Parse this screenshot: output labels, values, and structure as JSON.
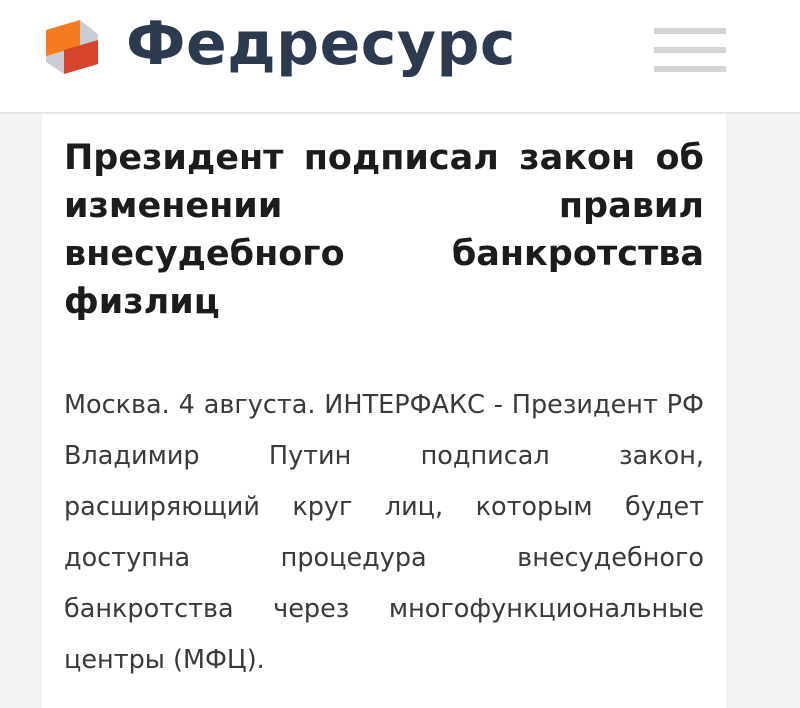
{
  "header": {
    "brand_name": "Федресурс",
    "logo_icon": "fedresurs-logo-icon",
    "menu_icon": "hamburger-menu-icon",
    "colors": {
      "brand_text": "#2b3a4f",
      "logo_orange": "#f47b20",
      "logo_red": "#d6452b",
      "logo_grey": "#c9cdd3"
    }
  },
  "article": {
    "title": "Президент подписал закон об изменении правил внесудебного банкротства физлиц",
    "lead": "Москва. 4 августа. ИНТЕРФАКС - Президент РФ Владимир Путин подписал закон, расширяющий круг лиц, которым будет доступна процедура внесудебного банкротства через многофункциональные центры (МФЦ)."
  }
}
